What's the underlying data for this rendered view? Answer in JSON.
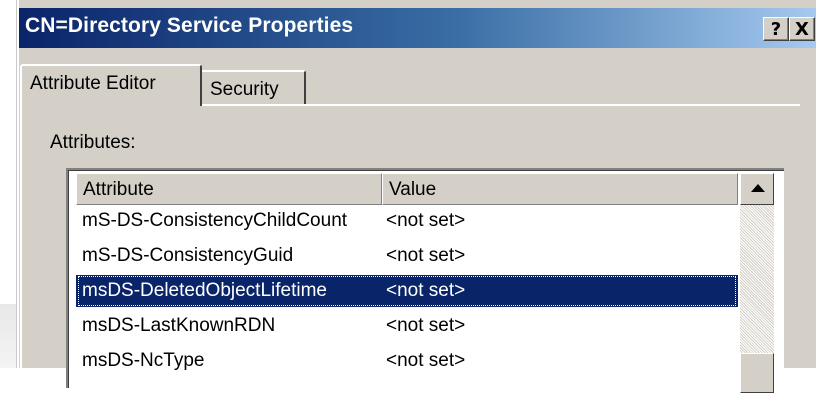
{
  "window": {
    "title": "CN=Directory Service Properties",
    "help_label": "?",
    "close_label": "X"
  },
  "tabs": [
    {
      "label": "Attribute Editor",
      "selected": true
    },
    {
      "label": "Security",
      "selected": false
    }
  ],
  "attributes": {
    "label": "Attributes:",
    "columns": [
      "Attribute",
      "Value"
    ],
    "rows": [
      {
        "attribute": "mS-DS-ConsistencyChildCount",
        "value": "<not set>",
        "selected": false
      },
      {
        "attribute": "mS-DS-ConsistencyGuid",
        "value": "<not set>",
        "selected": false
      },
      {
        "attribute": "msDS-DeletedObjectLifetime",
        "value": "<not set>",
        "selected": true
      },
      {
        "attribute": "msDS-LastKnownRDN",
        "value": "<not set>",
        "selected": false
      },
      {
        "attribute": "msDS-NcType",
        "value": "<not set>",
        "selected": false
      }
    ]
  },
  "colors": {
    "selection": "#0a246a",
    "dialog_face": "#d4d0c8",
    "title_gradient_start": "#0a246a",
    "title_gradient_end": "#a6caf0"
  },
  "icons": {
    "scroll_up": "scroll-up-arrow-icon"
  }
}
